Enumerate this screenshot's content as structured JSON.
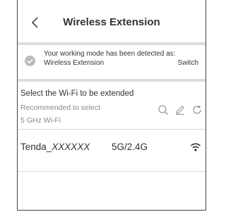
{
  "header": {
    "title": "Wireless Extension",
    "back_icon": "chevron-left-icon"
  },
  "notice": {
    "icon": "check-circle-icon",
    "line1": "Your working mode has been detected as:",
    "mode": "Wireless Extension",
    "switch_label": "Switch"
  },
  "select": {
    "title": "Select the Wi-Fi to be extended",
    "recommend_line1": "Recommended to select",
    "recommend_line2": "5 GHz Wi-Fi",
    "tools": [
      "search-icon",
      "edit-icon",
      "refresh-icon"
    ]
  },
  "networks": [
    {
      "ssid_prefix": "Tenda_",
      "ssid_suffix": "XXXXXX",
      "band": "5G/2.4G",
      "signal_icon": "wifi-signal-icon"
    }
  ],
  "colors": {
    "separator": "#dddddd",
    "text": "#333333",
    "muted": "#888888",
    "icon": "#999999"
  }
}
